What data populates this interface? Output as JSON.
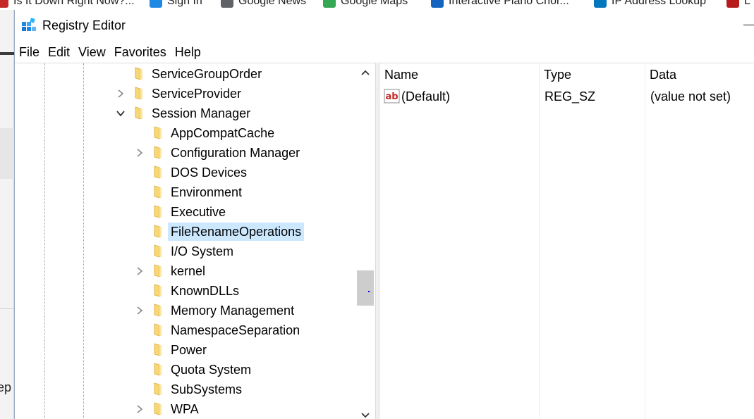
{
  "browser_bookmarks": [
    {
      "label": "Is It Down Right Now?...",
      "icon": "status-icon",
      "color": "#c62828"
    },
    {
      "label": "Sign In",
      "icon": "windows-logo-icon",
      "color": "#1e88e5"
    },
    {
      "label": "Google News",
      "icon": "news-icon",
      "color": "#5f6368"
    },
    {
      "label": "Google Maps",
      "icon": "maps-icon",
      "color": "#34a853"
    },
    {
      "label": "Interactive Piano Chor...",
      "icon": "globe-icon",
      "color": "#1565c0"
    },
    {
      "label": "IP Address Lookup",
      "icon": "globe-icon",
      "color": "#0277bd"
    },
    {
      "label": "L",
      "icon": "wu-logo-icon",
      "color": "#b71c1c"
    }
  ],
  "background_app": {
    "text_fragment": "ep"
  },
  "window": {
    "title": "Registry Editor",
    "app_icon": "registry-editor-icon"
  },
  "menu": [
    "File",
    "Edit",
    "View",
    "Favorites",
    "Help"
  ],
  "tree": {
    "items": [
      {
        "label": "ServiceGroupOrder",
        "level": 0,
        "expander": "none"
      },
      {
        "label": "ServiceProvider",
        "level": 0,
        "expander": "collapsed"
      },
      {
        "label": "Session Manager",
        "level": 0,
        "expander": "expanded"
      },
      {
        "label": "AppCompatCache",
        "level": 1,
        "expander": "none"
      },
      {
        "label": "Configuration Manager",
        "level": 1,
        "expander": "collapsed"
      },
      {
        "label": "DOS Devices",
        "level": 1,
        "expander": "none"
      },
      {
        "label": "Environment",
        "level": 1,
        "expander": "none"
      },
      {
        "label": "Executive",
        "level": 1,
        "expander": "none"
      },
      {
        "label": "FileRenameOperations",
        "level": 1,
        "expander": "none",
        "selected": true
      },
      {
        "label": "I/O System",
        "level": 1,
        "expander": "none"
      },
      {
        "label": "kernel",
        "level": 1,
        "expander": "collapsed"
      },
      {
        "label": "KnownDLLs",
        "level": 1,
        "expander": "none"
      },
      {
        "label": "Memory Management",
        "level": 1,
        "expander": "collapsed"
      },
      {
        "label": "NamespaceSeparation",
        "level": 1,
        "expander": "none"
      },
      {
        "label": "Power",
        "level": 1,
        "expander": "none"
      },
      {
        "label": "Quota System",
        "level": 1,
        "expander": "none"
      },
      {
        "label": "SubSystems",
        "level": 1,
        "expander": "none"
      },
      {
        "label": "WPA",
        "level": 1,
        "expander": "collapsed"
      }
    ],
    "colors": {
      "folder": "#f8d775",
      "folder_edge": "#d9a93a",
      "selection": "#cce8ff"
    }
  },
  "values_pane": {
    "columns": [
      "Name",
      "Type",
      "Data"
    ],
    "rows": [
      {
        "name": "(Default)",
        "type": "REG_SZ",
        "data": "(value not set)",
        "icon": "string-value-icon"
      }
    ]
  }
}
